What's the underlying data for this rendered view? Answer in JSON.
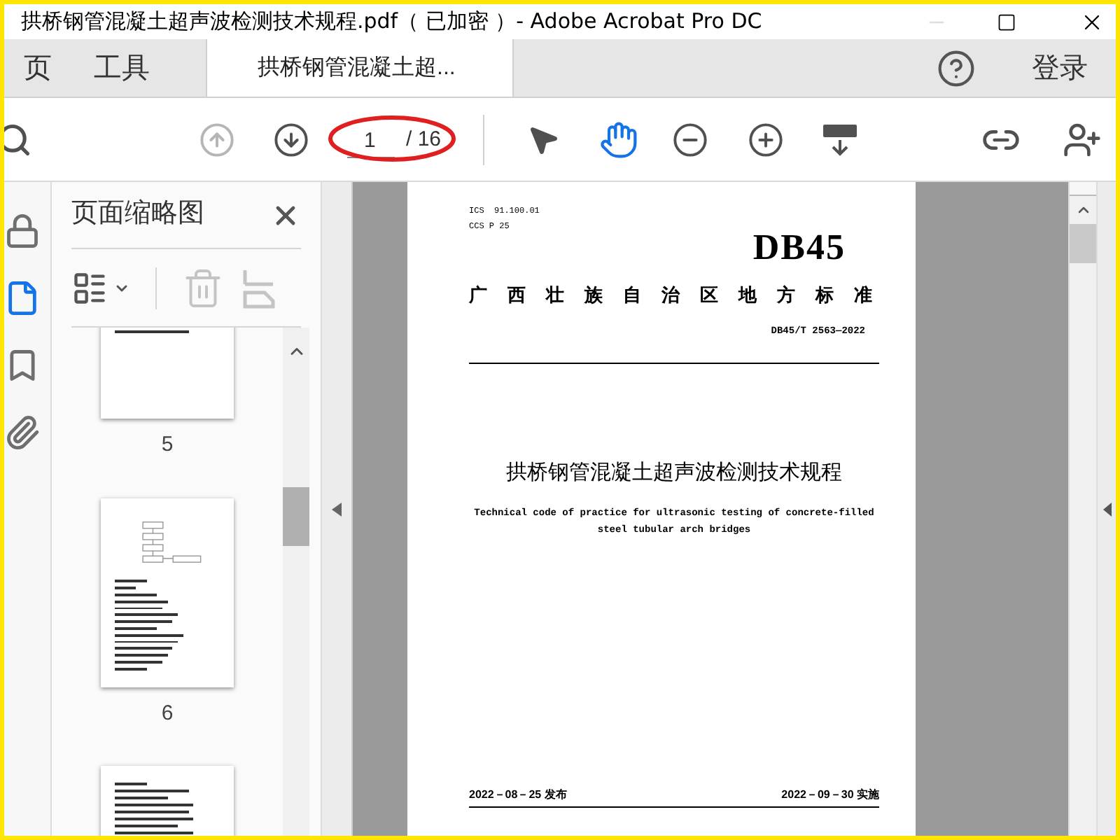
{
  "window": {
    "title": "拱桥钢管混凝土超声波检测技术规程.pdf（ 已加密 ）- Adobe Acrobat Pro DC"
  },
  "tabs": [
    {
      "label": "页",
      "kind": "nav",
      "selected": false
    },
    {
      "label": "工具",
      "kind": "nav",
      "selected": false
    },
    {
      "label": "拱桥钢管混凝土超...",
      "kind": "document",
      "selected": true
    }
  ],
  "account": {
    "sign_in": "登录"
  },
  "toolbar": {
    "page_current": "1",
    "page_total": "/ 16",
    "nav_buttons": [
      {
        "kind": "prev-page",
        "disabled": true
      },
      {
        "kind": "next-page",
        "disabled": false
      }
    ],
    "tools": [
      {
        "kind": "select",
        "selected": false
      },
      {
        "kind": "hand",
        "selected": true
      }
    ]
  },
  "left_rail": [
    {
      "kind": "lock",
      "selected": false
    },
    {
      "kind": "pages",
      "selected": true
    },
    {
      "kind": "bookmark",
      "selected": false
    },
    {
      "kind": "attachment",
      "selected": false
    }
  ],
  "thumbnail_panel": {
    "title": "页面缩略图",
    "tools": [
      {
        "kind": "options",
        "disabled": false
      },
      {
        "kind": "delete",
        "disabled": true
      },
      {
        "kind": "extract",
        "disabled": true
      }
    ],
    "pages": [
      {
        "label": "5",
        "kind": "list"
      },
      {
        "label": "6",
        "kind": "flowchart"
      },
      {
        "kind": "text"
      }
    ]
  },
  "document": {
    "ics": "ICS  91.100.01",
    "ccs": "CCS P 25",
    "logo": "DB45",
    "issuer": "广西壮族自治区地方标准",
    "code": "DB45/T 2563—2022",
    "title": "拱桥钢管混凝土超声波检测技术规程",
    "english_title": "Technical code of practice for ultrasonic testing of concrete-filled steel tubular arch bridges",
    "issue_date": "2022－08－25 发布",
    "effective_date": "2022－09－30 实施"
  }
}
